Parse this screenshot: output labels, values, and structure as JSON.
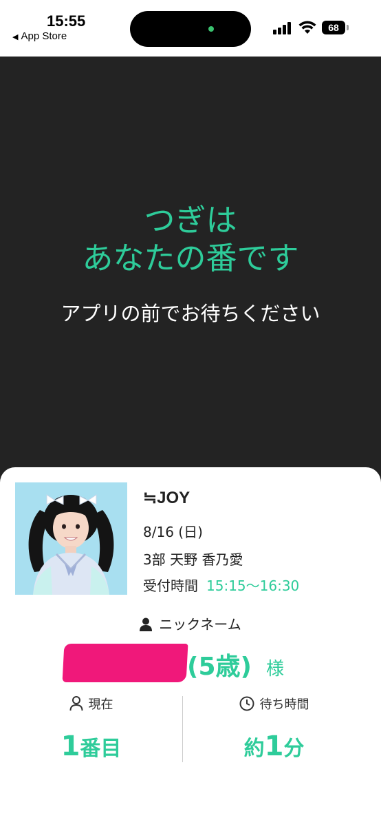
{
  "status_bar": {
    "time": "15:55",
    "back_label": "App Store",
    "battery": "68",
    "icons": [
      "signal-icon",
      "wifi-icon",
      "battery-icon"
    ]
  },
  "hero": {
    "title_line1": "つぎは",
    "title_line2": "あなたの番です",
    "subtitle": "アプリの前でお待ちください"
  },
  "card": {
    "group": "≒JOY",
    "date": "8/16 (日)",
    "session": "3部 天野 香乃愛",
    "reception_label": "受付時間",
    "reception_time": "15:15〜16:30",
    "nickname_label": "ニックネーム",
    "age": "(5歳)",
    "honorific": "様",
    "current_label": "現在",
    "current_number": "1",
    "current_suffix": "番目",
    "wait_label": "待ち時間",
    "wait_prefix": "約",
    "wait_number": "1",
    "wait_suffix": "分"
  },
  "colors": {
    "accent": "#2ecc9a",
    "hero_bg": "#232323",
    "redaction": "#f0187a"
  }
}
